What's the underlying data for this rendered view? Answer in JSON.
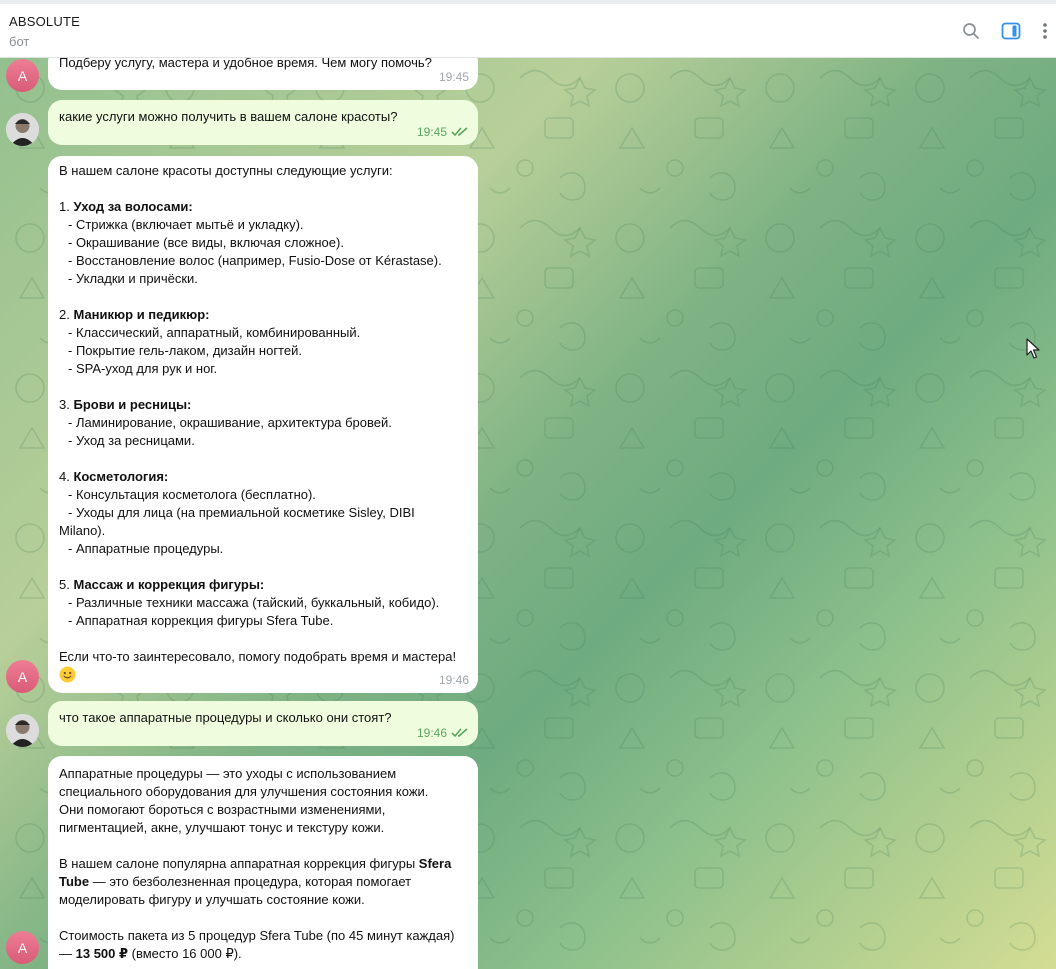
{
  "header": {
    "title": "ABSOLUTE",
    "subtitle": "бот"
  },
  "icons": {
    "search": "search-icon",
    "sidebar": "sidebar-toggle-icon",
    "more": "more-vertical-icon"
  },
  "avatars": {
    "bot_letter": "A"
  },
  "messages": {
    "m1": {
      "text": "Подберу услугу, мастера и удобное время. Чем могу помочь?",
      "time": "19:45"
    },
    "m2": {
      "text": "какие услуги можно получить в вашем салоне красоты?",
      "time": "19:45"
    },
    "m3": {
      "intro": "В нашем салоне красоты доступны следующие услуги:",
      "s1_num": "1. ",
      "s1_title": "Уход за волосами:",
      "s1_i1": "- Стрижка (включает мытьё и укладку).",
      "s1_i2": "- Окрашивание (все виды, включая сложное).",
      "s1_i3": "- Восстановление волос (например, Fusio-Dose от Kérastase).",
      "s1_i4": "- Укладки и причёски.",
      "s2_num": "2. ",
      "s2_title": "Маникюр и педикюр:",
      "s2_i1": "- Классический, аппаратный, комбинированный.",
      "s2_i2": "- Покрытие гель-лаком, дизайн ногтей.",
      "s2_i3": "- SPA-уход для рук и ног.",
      "s3_num": "3. ",
      "s3_title": "Брови и ресницы:",
      "s3_i1": "- Ламинирование, окрашивание, архитектура бровей.",
      "s3_i2": "- Уход за ресницами.",
      "s4_num": "4. ",
      "s4_title": "Косметология:",
      "s4_i1": "- Консультация косметолога (бесплатно).",
      "s4_i2a": "- Уходы для лица (на премиальной косметике Sisley, DIBI",
      "s4_i2b": "Milano).",
      "s4_i3": "- Аппаратные процедуры.",
      "s5_num": "5. ",
      "s5_title": "Массаж и коррекция фигуры:",
      "s5_i1": "- Различные техники массажа (тайский, буккальный, кобидо).",
      "s5_i2": "- Аппаратная коррекция фигуры Sfera Tube.",
      "outro": "Если что-то заинтересовало, помогу подобрать время и мастера!",
      "time": "19:46"
    },
    "m4": {
      "text": "что такое аппаратные процедуры и сколько они стоят?",
      "time": "19:46"
    },
    "m5": {
      "p1_l1": "Аппаратные процедуры — это уходы с использованием",
      "p1_l2": "специального оборудования для улучшения состояния кожи.",
      "p1_l3": "Они помогают бороться с возрастными изменениями,",
      "p1_l4": "пигментацией, акне, улучшают тонус и текстуру кожи.",
      "p2_l1a": "В нашем салоне популярна аппаратная коррекция фигуры ",
      "p2_l1b": "Sfera",
      "p2_l2a": "Tube",
      "p2_l2b": " — это безболезненная процедура, которая помогает",
      "p2_l3": "моделировать фигуру и улучшать состояние кожи.",
      "p3_l1": "Стоимость пакета из 5 процедур Sfera Tube (по 45 минут каждая)",
      "p3_l2a": "— ",
      "p3_l2b": "13 500 ₽",
      "p3_l2c": " (вместо 16 000 ₽)."
    }
  },
  "colors": {
    "bot_bubble": "#ffffff",
    "user_bubble": "#effdde",
    "check": "#5aa65f",
    "avatar_bot": "#e56b86"
  }
}
